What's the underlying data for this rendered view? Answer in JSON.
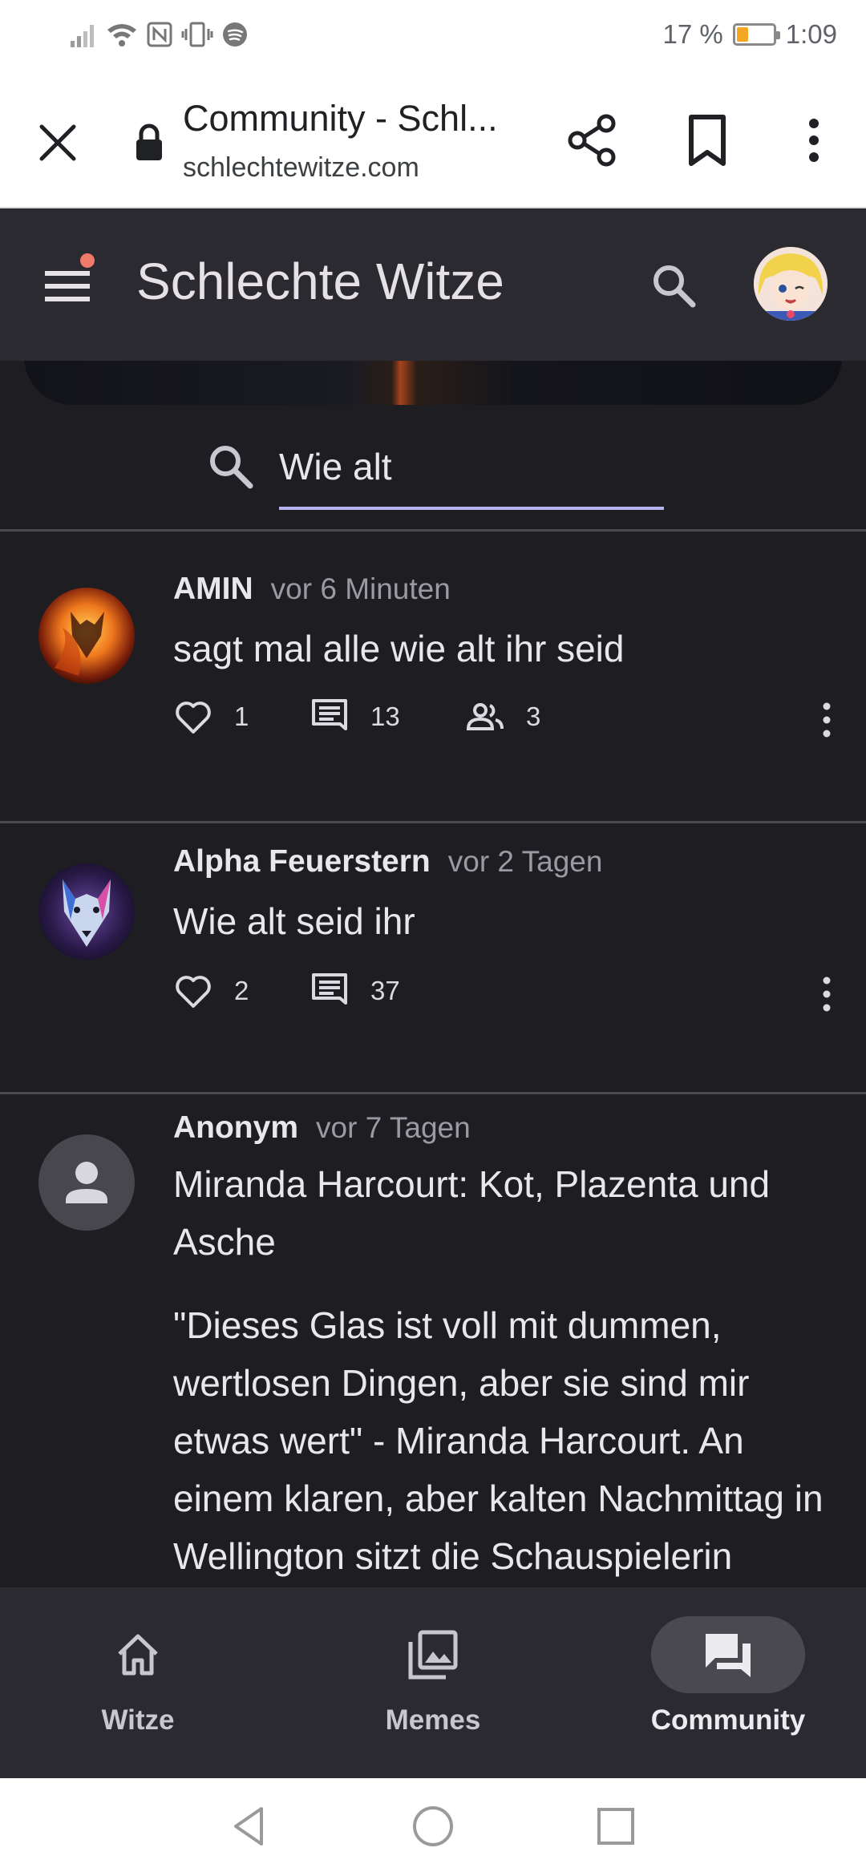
{
  "status_bar": {
    "battery_percent": "17 %",
    "battery_level": 0.17,
    "time": "1:09"
  },
  "browser": {
    "page_title": "Community - Schl...",
    "url": "schlechtewitze.com"
  },
  "app_header": {
    "title": "Schlechte Witze",
    "has_notification_dot": true
  },
  "search": {
    "query": "Wie alt"
  },
  "posts": [
    {
      "author": "AMIN",
      "time": "vor 6 Minuten",
      "text": "sagt mal alle wie alt ihr seid",
      "likes": "1",
      "comments": "13",
      "participants": "3"
    },
    {
      "author": "Alpha Feuerstern",
      "time": "vor 2 Tagen",
      "text": "Wie alt seid ihr",
      "likes": "2",
      "comments": "37"
    },
    {
      "author": "Anonym",
      "time": "vor 7 Tagen",
      "title": "Miranda Harcourt: Kot, Plazenta und Asche",
      "text": "\"Dieses Glas ist voll mit dummen, wertlosen Dingen, aber sie sind mir etwas wert\" - Miranda Harcourt. An einem klaren, aber kalten Nachmittag in Wellington sitzt die Schauspielerin"
    }
  ],
  "bottom_nav": {
    "items": [
      {
        "label": "Witze",
        "icon": "home-icon",
        "active": false
      },
      {
        "label": "Memes",
        "icon": "image-gallery-icon",
        "active": false
      },
      {
        "label": "Community",
        "icon": "forum-icon",
        "active": true
      }
    ]
  },
  "colors": {
    "app_bar": "#2b2a30",
    "background": "#1e1d22",
    "search_underline": "#b5b4ef",
    "notification_dot": "#f07a6a",
    "battery_low": "#f5a623"
  }
}
